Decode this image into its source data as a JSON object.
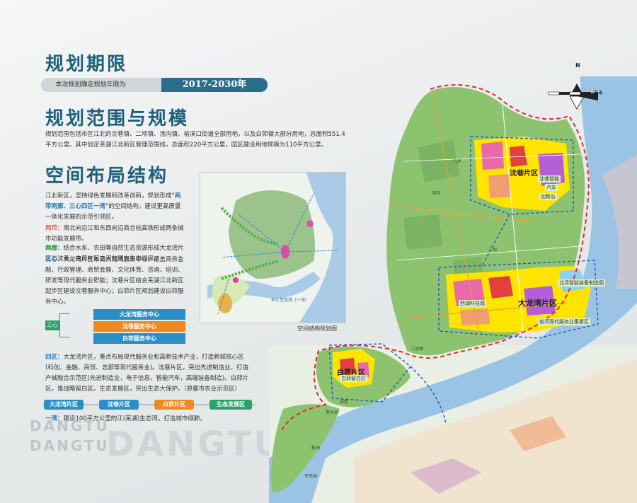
{
  "section1": {
    "title": "规划期限",
    "period_label": "本次规划确定规划年限为",
    "period_value": "2017-2030年"
  },
  "section2": {
    "title": "规划范围与规模",
    "text": "规划范围包括市区江北的沈巷镇、二坝镇、汤沟镇、裕溪口街道全部用地，以及白茆镇大部分用地，总面积551.4平方公里。其中划定芜湖江北新区管理范围线，总面积220平方公里，园区建设用地规模为110平方公里。"
  },
  "section3": {
    "title": "空间布局结构",
    "intro_a": "江北新区，坚持绿色发展和改革创新，规划形成“",
    "intro_highlight": "两带两廊、三心四区一湾",
    "intro_b": "”的空间结构，建设更高质量一体化发展的示范引领区。",
    "liangdai_key": "两带：",
    "liangdai_text": "南北向沿江和东西向沿商合杭高铁形成两条城市功能发展带。",
    "lianglang_key": "两廊：",
    "lianglang_text": "结合水系、农田等自然生态资源形成大龙湾片区与沈巷、白茆片区之间的两大生态绿廊。",
    "sanxin_key": "三心：",
    "sanxin_text": "大龙湾片区布局大龙湾服务中心，覆盖商务金融、行政管理、商贸会展、文化体育、咨询、培训、研发等现代服务业职能；沈巷片区结合芜湖江北新区起步区建设沈巷服务中心；白茆片区规划建设白茆服务中心。",
    "sanxin_label": "三心",
    "centers": [
      "大龙湾服务中心",
      "沈巷服务中心",
      "白茆服务中心"
    ],
    "sisi_key": "四区：",
    "sisi_text": "大龙湾片区，重点布局现代服务业和高新技术产业，打造新城核心区(科创、金融、商贸、总部等现代服务业)。沈巷片区，突出先进制造业，打造产城融合示范区(先进制造业，电子信息，智能汽车，高端装备制造)。白茆片区，是战略留白区。生态发展区，突出生态大保护。（原都市农业示范区）",
    "districts": [
      "大龙湾片区",
      "沈巷片区",
      "白茆片区",
      "生态发展区"
    ],
    "yiwan_key": "一湾：",
    "yiwan_text": "建设100平方公里的江(芜湖)生态湾，打造城市绿肺。",
    "mini_map_caption": "空间结构规划图",
    "mini_map_label": "长江生态湾（一湾）"
  },
  "watermark": {
    "line1": "DANGTU",
    "line2": "DANGTU",
    "big": "DANGTU"
  },
  "map": {
    "labels": {
      "shenxiang": "沈巷片区",
      "dalongwan": "大龙湾片区",
      "baimao": "白茆片区",
      "shenxiang_zhineng": "沈巷智能",
      "qiche": "汽车",
      "chuangxin": "创新谷",
      "xihu": "西湖科技城",
      "zhihui": "北湾智能装备制造园",
      "qianwan": "前湾现代服务业集聚区",
      "baimao_sub": "白茆留白区",
      "er_ba": "二坝",
      "tang_gou": "汤沟",
      "xin_zhou": "新洲",
      "tian_ran_zhou": "天然洲",
      "hei_sha_zhou": "黑沙洲",
      "er_ba_zhen": "二坝镇",
      "lv_se": "绿色",
      "ba_xiang": "八乡"
    },
    "scale_label": "千米",
    "north": "N",
    "colors": {
      "green": "#8dc36f",
      "river": "#9bc4e4",
      "boundary": "#e02b2b",
      "core": "#ffe400"
    }
  }
}
